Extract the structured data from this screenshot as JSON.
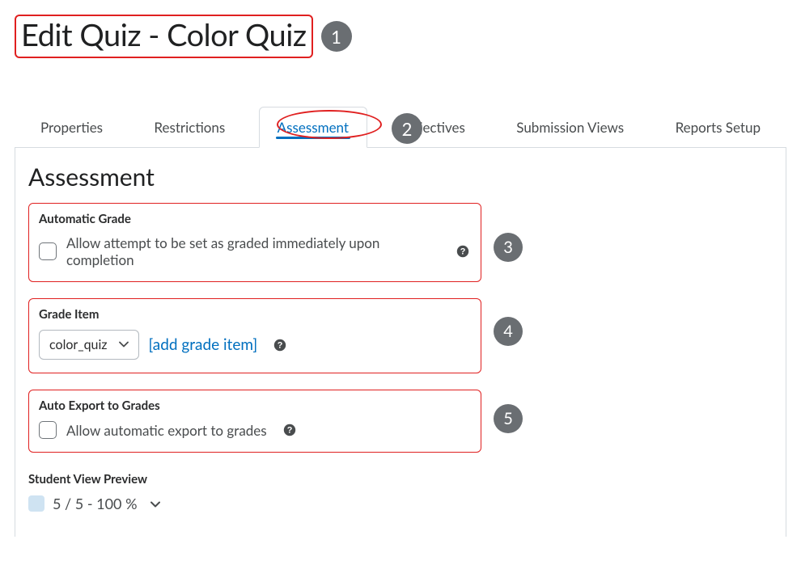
{
  "page_title": "Edit Quiz - Color Quiz",
  "callouts": {
    "c1": "1",
    "c2": "2",
    "c3": "3",
    "c4": "4",
    "c5": "5"
  },
  "tabs": {
    "properties": "Properties",
    "restrictions": "Restrictions",
    "assessment": "Assessment",
    "objectives": "Objectives",
    "submission_views": "Submission Views",
    "reports_setup": "Reports Setup"
  },
  "section_title": "Assessment",
  "automatic_grade": {
    "heading": "Automatic Grade",
    "option_label": "Allow attempt to be set as graded immediately upon completion"
  },
  "grade_item": {
    "heading": "Grade Item",
    "selected": "color_quiz",
    "add_link": "[add grade item]"
  },
  "auto_export": {
    "heading": "Auto Export to Grades",
    "option_label": "Allow automatic export to grades"
  },
  "student_view_preview": {
    "heading": "Student View Preview",
    "value": "5 / 5 - 100 %"
  }
}
